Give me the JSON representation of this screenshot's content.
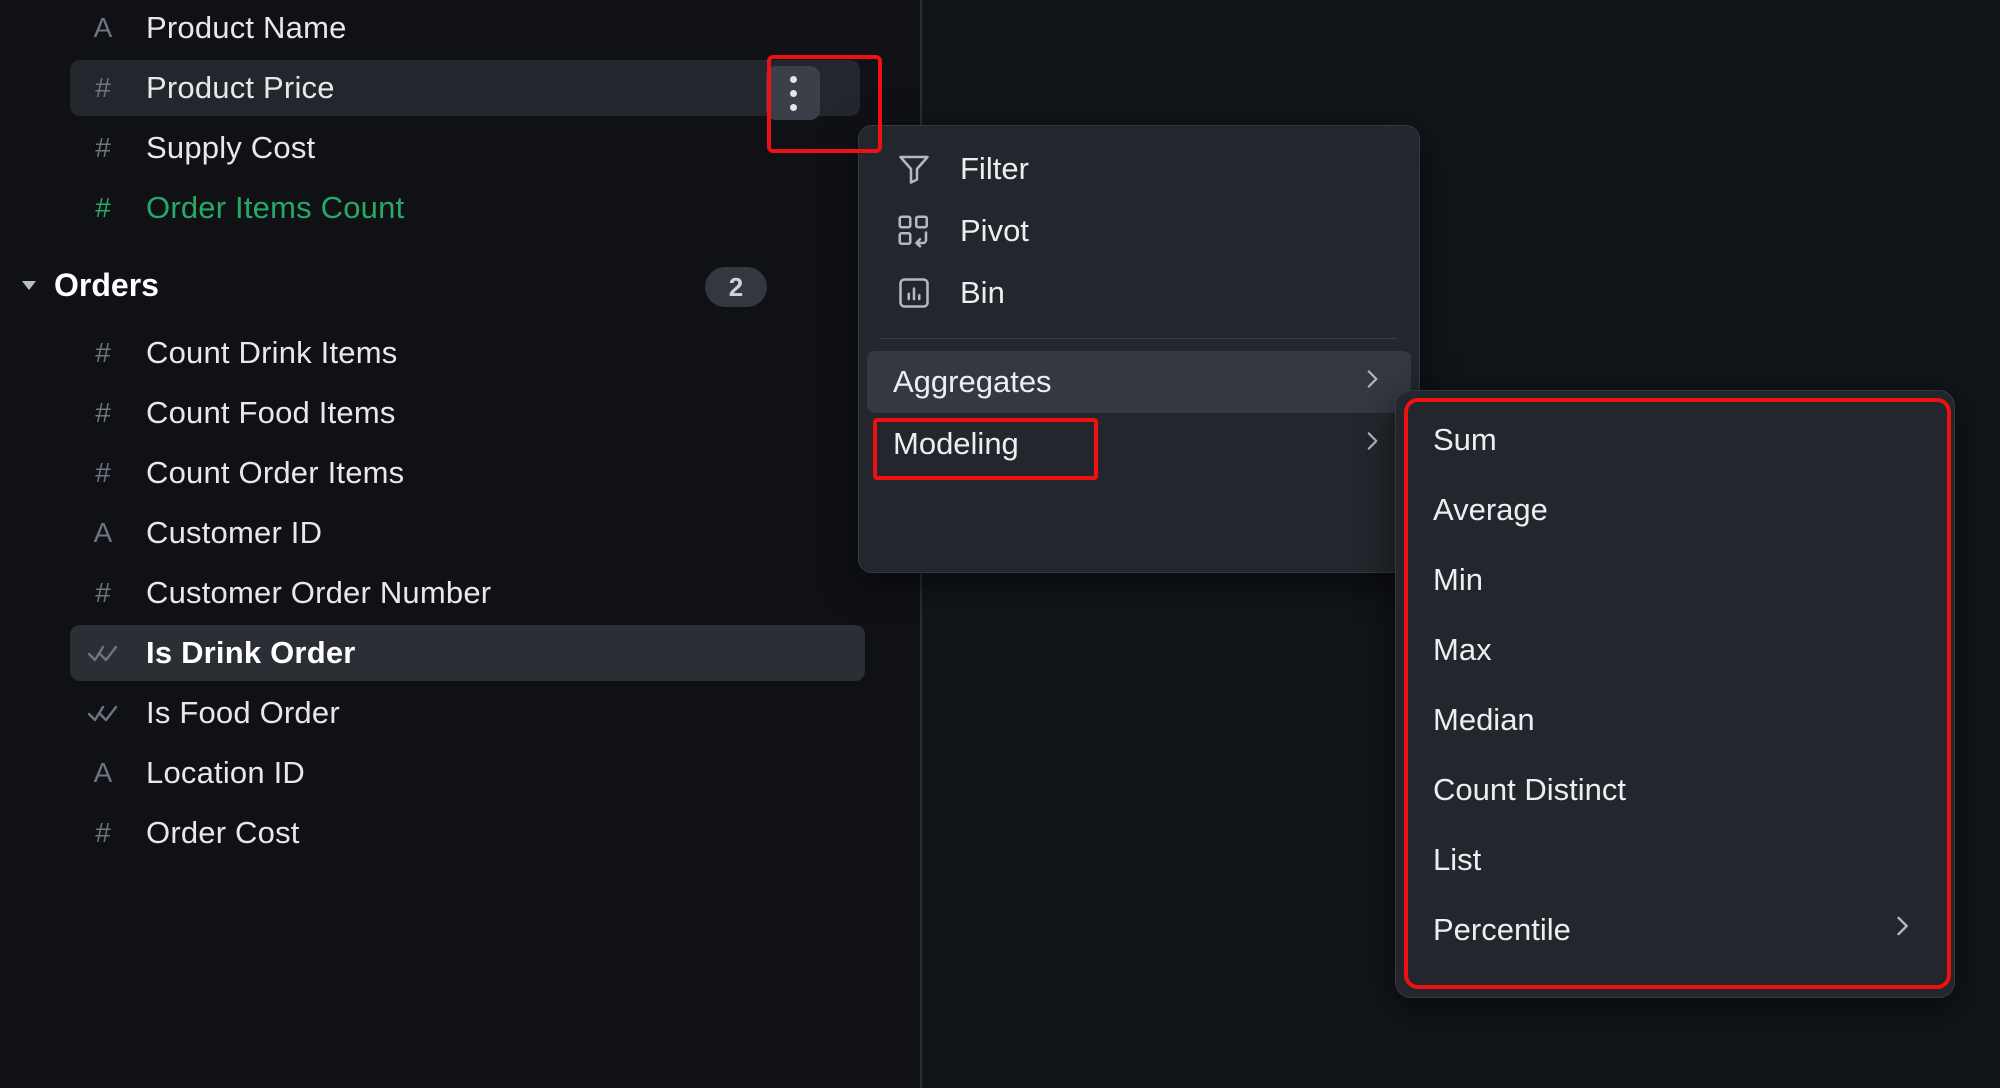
{
  "sidebar": {
    "top_fields": [
      {
        "label": "Product Name",
        "icon": "text-type-icon",
        "glyph": "A",
        "accent": false,
        "state": "normal"
      },
      {
        "label": "Product Price",
        "icon": "number-type-icon",
        "glyph": "#",
        "accent": false,
        "state": "selected"
      },
      {
        "label": "Supply Cost",
        "icon": "number-type-icon",
        "glyph": "#",
        "accent": false,
        "state": "normal"
      },
      {
        "label": "Order Items Count",
        "icon": "number-type-icon",
        "glyph": "#",
        "accent": true,
        "state": "normal"
      }
    ],
    "group": {
      "title": "Orders",
      "count": "2",
      "caret": "caret-down-icon",
      "expanded": true
    },
    "group_fields": [
      {
        "label": "Count Drink Items",
        "icon": "number-type-icon",
        "glyph": "#",
        "state": "normal"
      },
      {
        "label": "Count Food Items",
        "icon": "number-type-icon",
        "glyph": "#",
        "state": "normal"
      },
      {
        "label": "Count Order Items",
        "icon": "number-type-icon",
        "glyph": "#",
        "state": "normal"
      },
      {
        "label": "Customer ID",
        "icon": "text-type-icon",
        "glyph": "A",
        "state": "normal"
      },
      {
        "label": "Customer Order Number",
        "icon": "number-type-icon",
        "glyph": "#",
        "state": "normal"
      },
      {
        "label": "Is Drink Order",
        "icon": "boolean-type-icon",
        "glyph": "check",
        "state": "selected-strong"
      },
      {
        "label": "Is Food Order",
        "icon": "boolean-type-icon",
        "glyph": "check",
        "state": "normal"
      },
      {
        "label": "Location ID",
        "icon": "text-type-icon",
        "glyph": "A",
        "state": "normal"
      },
      {
        "label": "Order Cost",
        "icon": "number-type-icon",
        "glyph": "#",
        "state": "normal"
      }
    ],
    "kebab_button": "field-options-button"
  },
  "context_menu": {
    "items": [
      {
        "label": "Filter",
        "icon": "filter-icon",
        "has_submenu": false,
        "highlighted": false
      },
      {
        "label": "Pivot",
        "icon": "pivot-icon",
        "has_submenu": false,
        "highlighted": false
      },
      {
        "label": "Bin",
        "icon": "bin-chart-icon",
        "has_submenu": false,
        "highlighted": false
      }
    ],
    "items_after_divider": [
      {
        "label": "Aggregates",
        "icon": null,
        "has_submenu": true,
        "highlighted": true
      },
      {
        "label": "Modeling",
        "icon": null,
        "has_submenu": true,
        "highlighted": false
      }
    ]
  },
  "submenu": {
    "title": "Aggregates",
    "items": [
      {
        "label": "Sum",
        "has_submenu": false
      },
      {
        "label": "Average",
        "has_submenu": false
      },
      {
        "label": "Min",
        "has_submenu": false
      },
      {
        "label": "Max",
        "has_submenu": false
      },
      {
        "label": "Median",
        "has_submenu": false
      },
      {
        "label": "Count Distinct",
        "has_submenu": false
      },
      {
        "label": "List",
        "has_submenu": false
      },
      {
        "label": "Percentile",
        "has_submenu": true
      }
    ]
  },
  "annotations": {
    "highlight_color": "#ee1111",
    "boxes": [
      "field-options-button",
      "aggregates-menu-item",
      "aggregates-submenu-panel"
    ]
  },
  "colors": {
    "background": "#0f1115",
    "panel": "#23262c",
    "hover": "#343841",
    "accent_green": "#28a866",
    "text": "#e6e8ea"
  }
}
